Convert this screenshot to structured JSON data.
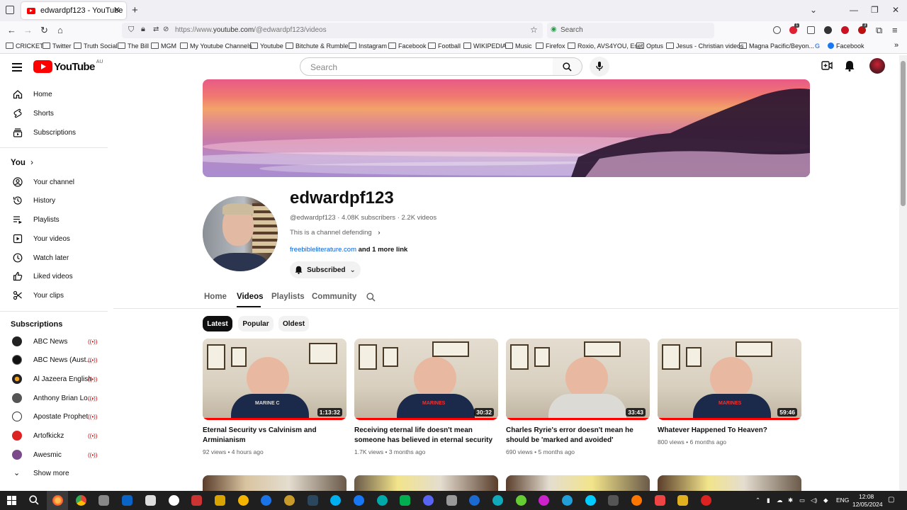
{
  "browser": {
    "tab_title": "edwardpf123 - YouTube",
    "url_prefix": "https://www.",
    "url_host": "youtube.com",
    "url_path": "/@edwardpf123/videos",
    "search_placeholder": "Search",
    "ext_badge_1": "1",
    "ext_badge_2": "3",
    "bookmarks": [
      "CRICKET",
      "Twitter",
      "Truth Social",
      "The Bill",
      "MGM",
      "My Youtube Channels",
      "Youtube",
      "Bitchute & Rumble",
      "Instagram",
      "Facebook",
      "Football",
      "WIKIPEDIA",
      "Music",
      "Firefox",
      "Roxio, AVS4YOU, Eset",
      "Optus",
      "Jesus - Christian videos",
      "Magna Pacific/Beyon...",
      "Facebook"
    ]
  },
  "masthead": {
    "logo_text": "YouTube",
    "region": "AU",
    "search_placeholder": "Search"
  },
  "sidebar": {
    "main": [
      "Home",
      "Shorts",
      "Subscriptions"
    ],
    "you_heading": "You",
    "you_items": [
      "Your channel",
      "History",
      "Playlists",
      "Your videos",
      "Watch later",
      "Liked videos",
      "Your clips"
    ],
    "subs_heading": "Subscriptions",
    "subs": [
      "ABC News",
      "ABC News (Aust...",
      "Al Jazeera English",
      "Anthony Brian Lo...",
      "Apostate Prophet",
      "Artofkickz",
      "Awesmic"
    ],
    "show_more": "Show more"
  },
  "channel": {
    "name": "edwardpf123",
    "meta": "@edwardpf123 · 4.08K subscribers · 2.2K videos",
    "description": "This is a channel defending",
    "link": "freebibleliterature.com",
    "more_links": "and 1 more link",
    "subscribe_label": "Subscribed",
    "tabs": [
      "Home",
      "Videos",
      "Playlists",
      "Community"
    ],
    "active_tab": "Videos"
  },
  "filters": {
    "chips": [
      "Latest",
      "Popular",
      "Oldest"
    ],
    "active": "Latest"
  },
  "videos": [
    {
      "title": "Eternal Security vs Calvinism and Arminianism",
      "duration": "1:13:32",
      "views": "92 views",
      "age": "4 hours ago",
      "shirt": "MARINE C"
    },
    {
      "title": "Receiving eternal life doesn't mean someone has believed in eternal security",
      "duration": "30:32",
      "views": "1.7K views",
      "age": "3 months ago",
      "shirt": "MARINES"
    },
    {
      "title": "Charles Ryrie's error doesn't mean he should be 'marked and avoided'",
      "duration": "33:43",
      "views": "690 views",
      "age": "5 months ago",
      "shirt": ""
    },
    {
      "title": "Whatever Happened To Heaven?",
      "duration": "59:46",
      "views": "800 views",
      "age": "6 months ago",
      "shirt": "MARINES"
    }
  ],
  "taskbar": {
    "lang": "ENG",
    "time": "12:08",
    "date": "12/05/2024"
  },
  "colors": {
    "yt_red": "#ff0000",
    "link_blue": "#065fd4",
    "chip_dark": "#0f0f0f"
  }
}
